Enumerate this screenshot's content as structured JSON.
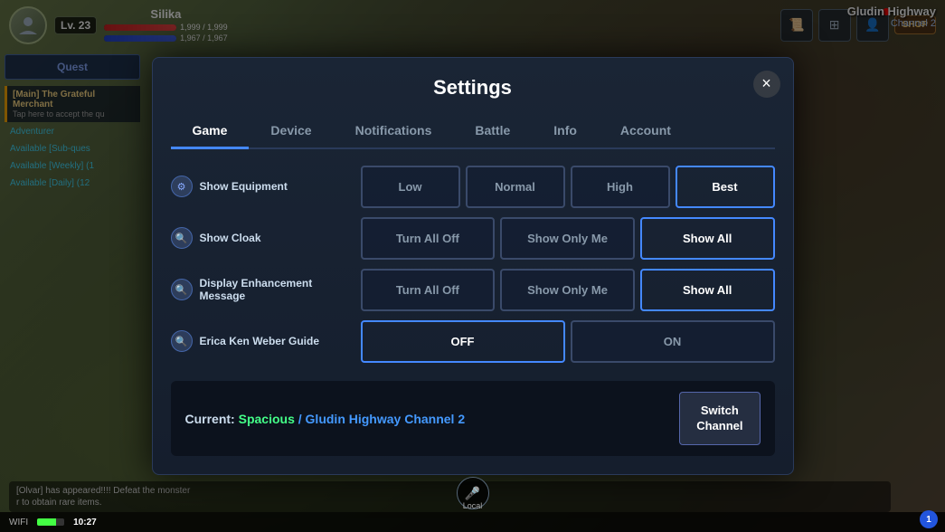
{
  "game": {
    "bg_label": "game_background"
  },
  "hud": {
    "level": "Lv. 23",
    "player_name": "Silika",
    "hp": "1,999 / 1,999",
    "mp": "1,967 / 1,967",
    "location": "Gludin Highway",
    "channel": "Channel 2"
  },
  "quest_panel": {
    "quest_btn": "Quest",
    "main_quest_title": "[Main] The Grateful Merchant",
    "main_quest_desc": "Tap here to accept the qu",
    "adventurer_label": "Adventurer",
    "sub_quest_label": "Available [Sub-ques",
    "weekly_label": "Available [Weekly] (1",
    "daily_label": "Available [Daily] (12"
  },
  "settings": {
    "title": "Settings",
    "close_label": "×",
    "tabs": [
      {
        "id": "game",
        "label": "Game",
        "active": true
      },
      {
        "id": "device",
        "label": "Device",
        "active": false
      },
      {
        "id": "notifications",
        "label": "Notifications",
        "active": false
      },
      {
        "id": "battle",
        "label": "Battle",
        "active": false
      },
      {
        "id": "info",
        "label": "Info",
        "active": false
      },
      {
        "id": "account",
        "label": "Account",
        "active": false
      }
    ],
    "rows": [
      {
        "id": "show_equipment",
        "label": "Show Equipment",
        "options": [
          {
            "label": "Low",
            "active": false
          },
          {
            "label": "Normal",
            "active": false
          },
          {
            "label": "High",
            "active": false
          },
          {
            "label": "Best",
            "active": true
          }
        ]
      },
      {
        "id": "show_cloak",
        "label": "Show Cloak",
        "options": [
          {
            "label": "Turn All Off",
            "active": false
          },
          {
            "label": "Show Only Me",
            "active": false
          },
          {
            "label": "Show All",
            "active": true
          }
        ]
      },
      {
        "id": "display_enhancement",
        "label": "Display Enhancement Message",
        "options": [
          {
            "label": "Turn All Off",
            "active": false
          },
          {
            "label": "Show Only Me",
            "active": false
          },
          {
            "label": "Show All",
            "active": true
          }
        ]
      },
      {
        "id": "guide",
        "label": "Erica Ken Weber Guide",
        "options": [
          {
            "label": "OFF",
            "active": true
          },
          {
            "label": "ON",
            "active": false
          }
        ]
      }
    ],
    "bottom": {
      "current_label": "Current:",
      "channel_green": "Spacious",
      "channel_blue": "/ Gludin Highway Channel 2",
      "switch_btn_line1": "Switch",
      "switch_btn_line2": "Channel"
    }
  },
  "status_bar": {
    "wifi": "WIFI",
    "time": "10:27",
    "notification": "1"
  },
  "chat": {
    "msg1": "[Olvar] has appeared!!!! Defeat the monster",
    "msg2": "r to obtain rare items."
  }
}
